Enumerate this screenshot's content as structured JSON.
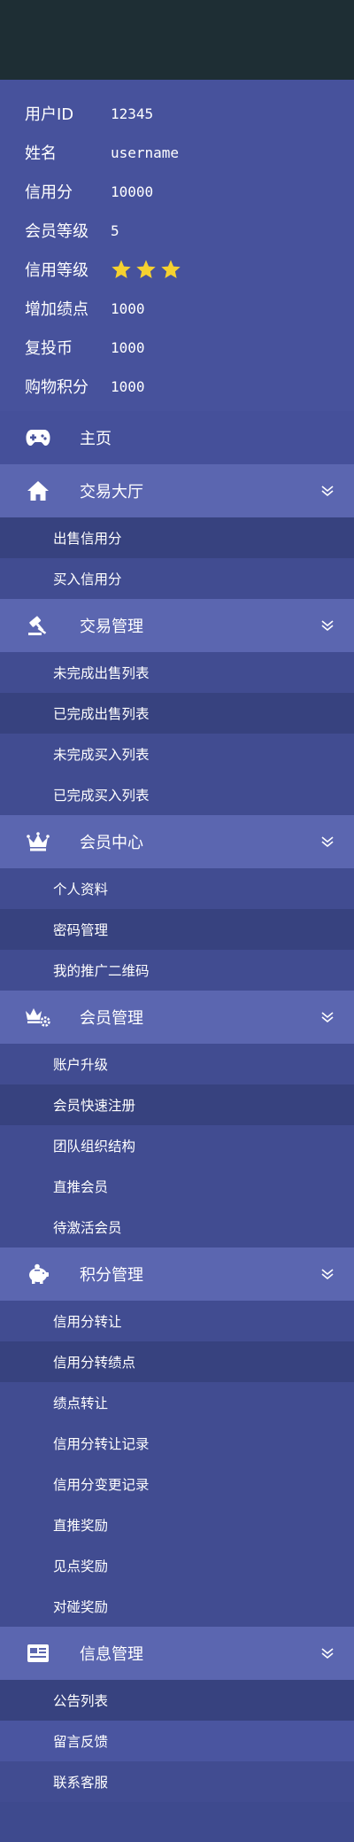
{
  "user_info": [
    {
      "label": "用户ID",
      "value": "12345"
    },
    {
      "label": "姓名",
      "value": "username"
    },
    {
      "label": "信用分",
      "value": "10000"
    },
    {
      "label": "会员等级",
      "value": "5"
    },
    {
      "label": "信用等级",
      "value": "",
      "stars": 3
    },
    {
      "label": "增加绩点",
      "value": "1000"
    },
    {
      "label": "复投币",
      "value": "1000"
    },
    {
      "label": "购物积分",
      "value": "1000"
    }
  ],
  "home": {
    "label": "主页",
    "icon": "gamepad-icon"
  },
  "sections": [
    {
      "label": "交易大厅",
      "icon": "home-icon",
      "items": [
        "出售信用分",
        "买入信用分"
      ]
    },
    {
      "label": "交易管理",
      "icon": "gavel-icon",
      "items": [
        "未完成出售列表",
        "已完成出售列表",
        "未完成买入列表",
        "已完成买入列表"
      ]
    },
    {
      "label": "会员中心",
      "icon": "crown-icon",
      "items": [
        "个人资料",
        "密码管理",
        "我的推广二维码"
      ]
    },
    {
      "label": "会员管理",
      "icon": "crown-gear-icon",
      "items": [
        "账户升级",
        "会员快速注册",
        "团队组织结构",
        "直推会员",
        "待激活会员"
      ]
    },
    {
      "label": "积分管理",
      "icon": "piggy-bank-icon",
      "items": [
        "信用分转让",
        "信用分转绩点",
        "绩点转让",
        "信用分转让记录",
        "信用分变更记录",
        "直推奖励",
        "见点奖励",
        "对碰奖励"
      ]
    },
    {
      "label": "信息管理",
      "icon": "news-card-icon",
      "items": [
        "公告列表",
        "留言反馈",
        "联系客服"
      ]
    }
  ],
  "colors": {
    "star": "#f5d130",
    "topbar": "#1e2e34",
    "panel": "#47529c",
    "section": "#5b66b0"
  }
}
